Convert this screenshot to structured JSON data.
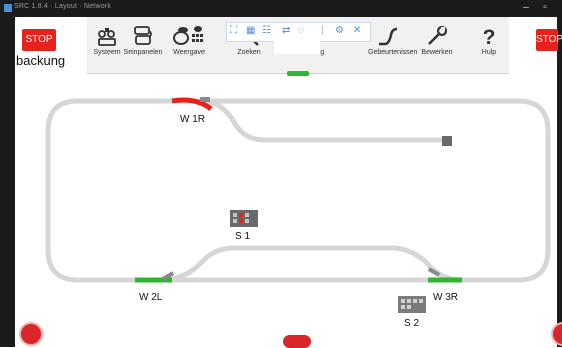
{
  "window": {
    "title": "SRC 1.8.4 · Layout · Network",
    "minimize": "–",
    "maximize": "▫"
  },
  "stop_left": "STOP",
  "stop_right": "STOP",
  "page_title": "backung",
  "toolbar": {
    "items": [
      {
        "id": "systeem",
        "label": "Systeem",
        "icon": "system-icon"
      },
      {
        "id": "seinpanelen",
        "label": "Seinpanelen",
        "icon": "panels-icon"
      },
      {
        "id": "weergave",
        "label": "Weergave",
        "icon": "view-icon"
      },
      {
        "id": "zoeken",
        "label": "Zoeken",
        "icon": "search-icon"
      },
      {
        "id": "sortering",
        "label": "Sortering",
        "icon": "sort-icon"
      },
      {
        "id": "gebeurtenissen",
        "label": "Gebeurtenissen",
        "icon": "events-icon"
      },
      {
        "id": "bewerken",
        "label": "Bewerken",
        "icon": "edit-icon"
      },
      {
        "id": "hulp",
        "label": "Hulp",
        "icon": "help-icon"
      }
    ]
  },
  "popbar": {
    "icons": [
      "fit-icon",
      "grid-icon",
      "list-icon",
      "swap-icon",
      "comment-icon",
      "divider-icon",
      "settings-icon",
      "close-icon"
    ]
  },
  "layout": {
    "turnouts": [
      {
        "name": "W 1R"
      },
      {
        "name": "W 2L"
      },
      {
        "name": "W 3R"
      }
    ],
    "signals": [
      {
        "name": "S 1"
      },
      {
        "name": "S 2"
      }
    ]
  },
  "colors": {
    "track": "#d6d6d6",
    "active": "#e8211c",
    "green": "#2fb52f",
    "signal": "#6a6a6a"
  }
}
